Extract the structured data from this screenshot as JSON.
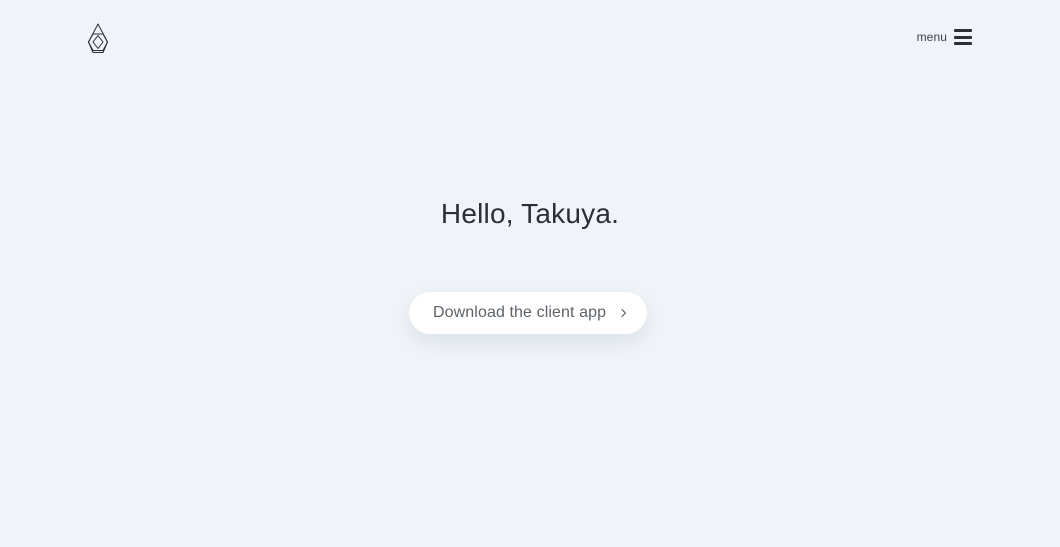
{
  "header": {
    "logo_icon": "geometric-logo-icon",
    "menu": {
      "label": "menu",
      "icon": "hamburger-icon"
    }
  },
  "main": {
    "greeting": "Hello, Takuya.",
    "download_button": {
      "label": "Download the client app",
      "icon": "chevron-right-icon"
    }
  },
  "colors": {
    "background": "#f0f4f8",
    "text": "#2b2f33",
    "button_background": "#ffffff",
    "button_text": "#5d6369"
  }
}
